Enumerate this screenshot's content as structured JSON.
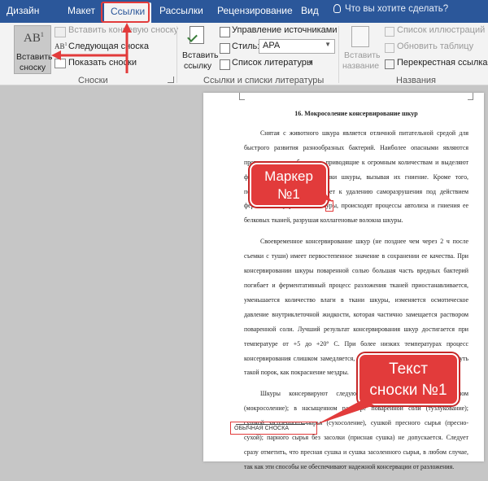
{
  "tabs": {
    "items": [
      "Дизайн",
      "Макет",
      "Ссылки",
      "Рассылки",
      "Рецензирование",
      "Вид"
    ],
    "active": "Ссылки",
    "tell_me": "Что вы хотите сделать?"
  },
  "ribbon": {
    "footnotes": {
      "insert_footnote_line1": "Вставить",
      "insert_footnote_line2": "сноску",
      "icon_text": "AB",
      "icon_sup": "1",
      "insert_endnote": "Вставить концевую сноску",
      "next_footnote": "Следующая сноска",
      "show_notes": "Показать сноски",
      "group_label": "Сноски"
    },
    "citations": {
      "insert_citation_line1": "Вставить",
      "insert_citation_line2": "ссылку",
      "manage_sources": "Управление источниками",
      "style_label": "Стиль:",
      "style_value": "APA",
      "bibliography": "Список литературы",
      "group_label": "Ссылки и списки литературы"
    },
    "captions": {
      "insert_caption_line1": "Вставить",
      "insert_caption_line2": "название",
      "table_of_figures": "Список иллюстраций",
      "update_table": "Обновить таблицу",
      "cross_reference": "Перекрестная ссылка",
      "group_label": "Названия"
    }
  },
  "document": {
    "heading": "16. Мокросоление консервирование шкур",
    "paragraphs": [
      "Снятая с животного шкура является отличной питательной средой для быстрого развития разнообразных бактерий. Наиболее опасными являются протеолитические бактерии, приводящие к огромным количествам и выделяют ферменты, разрушающие белки шкуры, вызывая их гниение. Кроме того, повышение температуры, ведет к удалению саморазрушения под действием ферментов внутри самой шкуры, происходят процессы автолиза и гниения ее белковых тканей, разрушая коллагеновые волокна шкуры.",
      "Своевременное консервирование шкур (не позднее чем через 2 ч после съемки с туши) имеет первостепенное значение в сохранении ее качества. При консервировании шкуры поваренной солью большая часть вредных бактерий погибает и ферментативный процесс разложения тканей приостанавливается, уменьшается количество влаги в ткани шкуры, изменяется осмотическое давление внутриклеточной жидкости, которая частично замещается раствором поваренной соли. Лучший результат консервирования шкур достигается при температуре от +5 до +20° С. При более низких температурах процесс консервирования слишком замедляется, а при более высокой может возникнуть такой порок, как покраснение мездры.",
      "Шкуры консервируют следующими способами: сухим посолом (мокросоление); в насыщенном растворе поваренной соли (тузлукование); сушкой засоленного сырья (сухосоление), сушкой пресного сырья (пресно-сухой); парного сырья без засолки (присная сушка) не допускается. Следует сразу отметить, что пресная сушка и сушка засоленного сырья, в любом случае, так как эти способы не обеспечивают надежной консервации от разложения."
    ],
    "footnote_text": "ОБЫЧНАЯ СНОСКА"
  },
  "annotations": {
    "marker_line1": "Маркер",
    "marker_line2": "№1",
    "note_line1": "Текст",
    "note_line2": "сноски №1"
  },
  "colors": {
    "ribbon_blue": "#2b579a",
    "callout_red": "#e23b3b"
  }
}
